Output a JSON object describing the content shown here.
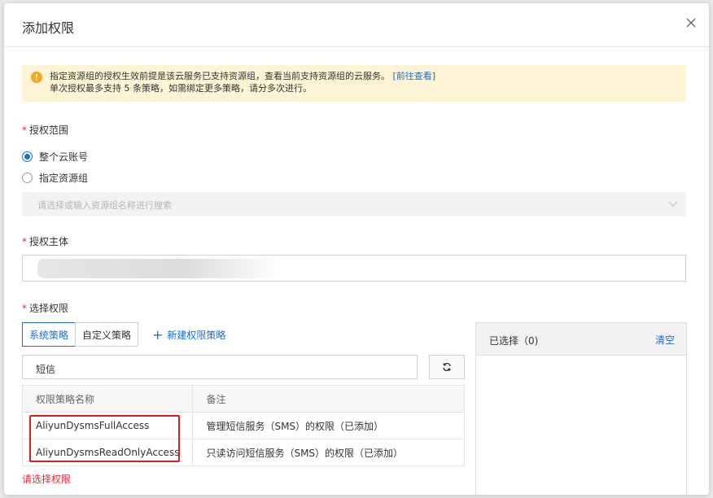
{
  "dialog": {
    "title": "添加权限"
  },
  "alert": {
    "line1": "指定资源组的授权生效前提是该云服务已支持资源组，查看当前支持资源组的云服务。",
    "link": "[前往查看]",
    "line2": "单次授权最多支持 5 条策略，如需绑定更多策略，请分多次进行。"
  },
  "scope": {
    "required_mark": "*",
    "label": "授权范围",
    "options": [
      {
        "label": "整个云账号",
        "checked": true
      },
      {
        "label": "指定资源组",
        "checked": false
      }
    ],
    "select_placeholder": "请选择或输入资源组名称进行搜索"
  },
  "principal": {
    "required_mark": "*",
    "label": "授权主体"
  },
  "permissions": {
    "required_mark": "*",
    "label": "选择权限",
    "tabs": [
      "系统策略",
      "自定义策略"
    ],
    "new_policy": "新建权限策略",
    "search_value": "短信",
    "table": {
      "headers": [
        "权限策略名称",
        "备注"
      ],
      "rows": [
        {
          "name": "AliyunDysmsFullAccess",
          "note": "管理短信服务（SMS）的权限（已添加）"
        },
        {
          "name": "AliyunDysmsReadOnlyAccess",
          "note": "只读访问短信服务（SMS）的权限（已添加）"
        }
      ]
    },
    "error": "请选择权限"
  },
  "selected": {
    "title": "已选择（0)",
    "clear": "清空"
  },
  "colors": {
    "accent": "#1a6ed8",
    "warning_bg": "#fdf3d5",
    "warning_icon": "#f5a623",
    "error": "#f5222d",
    "highlight": "#e01b1b"
  }
}
